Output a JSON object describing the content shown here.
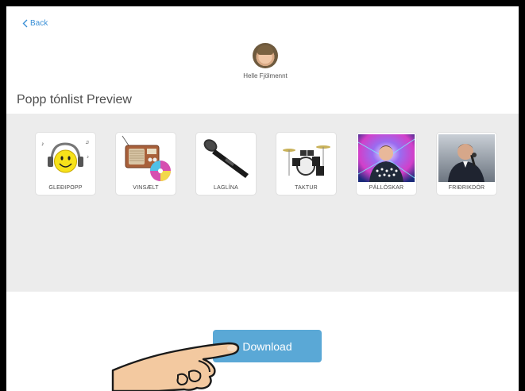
{
  "nav": {
    "back_label": "Back"
  },
  "profile": {
    "name": "Helle Fjölmennt"
  },
  "page": {
    "title": "Popp tónlist Preview"
  },
  "cards": [
    {
      "label": "GLEÐIPOPP",
      "icon": "smiley-headphones-icon"
    },
    {
      "label": "VINSÆLT",
      "icon": "radio-cd-icon"
    },
    {
      "label": "LAGLÍNA",
      "icon": "microphone-icon"
    },
    {
      "label": "TAKTUR",
      "icon": "drum-kit-icon"
    },
    {
      "label": "PÁLLÓSKAR",
      "icon": "performer-photo"
    },
    {
      "label": "FRIÐRIKDÓR",
      "icon": "singer-photo"
    }
  ],
  "actions": {
    "download_label": "Download"
  },
  "colors": {
    "accent": "#3a8fd6",
    "button": "#5aa8d6",
    "panel": "#ececec"
  }
}
